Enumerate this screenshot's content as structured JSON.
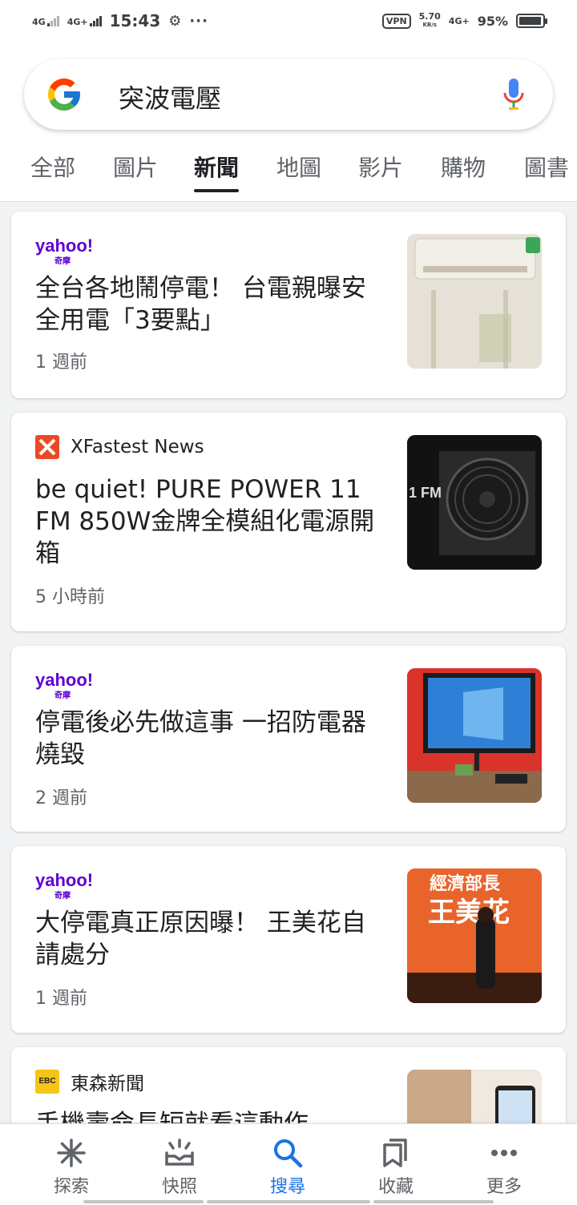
{
  "status": {
    "net1": "4G",
    "net2": "4G+",
    "time": "15:43",
    "vpn": "VPN",
    "speed": "5.70",
    "speed_unit": "KB/s",
    "net3": "4G+",
    "battery": "95%",
    "battery_level": 0.95
  },
  "search": {
    "query": "突波電壓"
  },
  "tabs": [
    {
      "label": "全部"
    },
    {
      "label": "圖片"
    },
    {
      "label": "新聞"
    },
    {
      "label": "地圖"
    },
    {
      "label": "影片"
    },
    {
      "label": "購物"
    },
    {
      "label": "圖書"
    }
  ],
  "active_tab": "新聞",
  "articles": [
    {
      "source_logo": "yahoo!",
      "source_logo_sub": "奇摩",
      "headline": "全台各地鬧停電！ 台電親曝安全用電「3要點」",
      "age": "1 週前"
    },
    {
      "source": "XFastest News",
      "headline": "be quiet! PURE POWER 11 FM 850W金牌全模組化電源開箱",
      "age": "5 小時前",
      "thumb_text": "1 FM"
    },
    {
      "source_logo": "yahoo!",
      "source_logo_sub": "奇摩",
      "headline": "停電後必先做這事 一招防電器燒毀",
      "age": "2 週前"
    },
    {
      "source_logo": "yahoo!",
      "source_logo_sub": "奇摩",
      "headline": "大停電真正原因曝！ 王美花自請處分",
      "age": "1 週前",
      "thumb_text_1": "經濟部長",
      "thumb_text_2": "王美花"
    },
    {
      "source": "東森新聞",
      "source_logo": "EBC",
      "headline": "手機壽命長短就看這動作"
    }
  ],
  "bottom_nav": [
    {
      "label": "探索"
    },
    {
      "label": "快照"
    },
    {
      "label": "搜尋"
    },
    {
      "label": "收藏"
    },
    {
      "label": "更多"
    }
  ],
  "colors": {
    "accent": "#1a73e8",
    "yahoo": "#6001d2",
    "xfastest": "#ea4a25",
    "ebc": "#f5c518"
  }
}
